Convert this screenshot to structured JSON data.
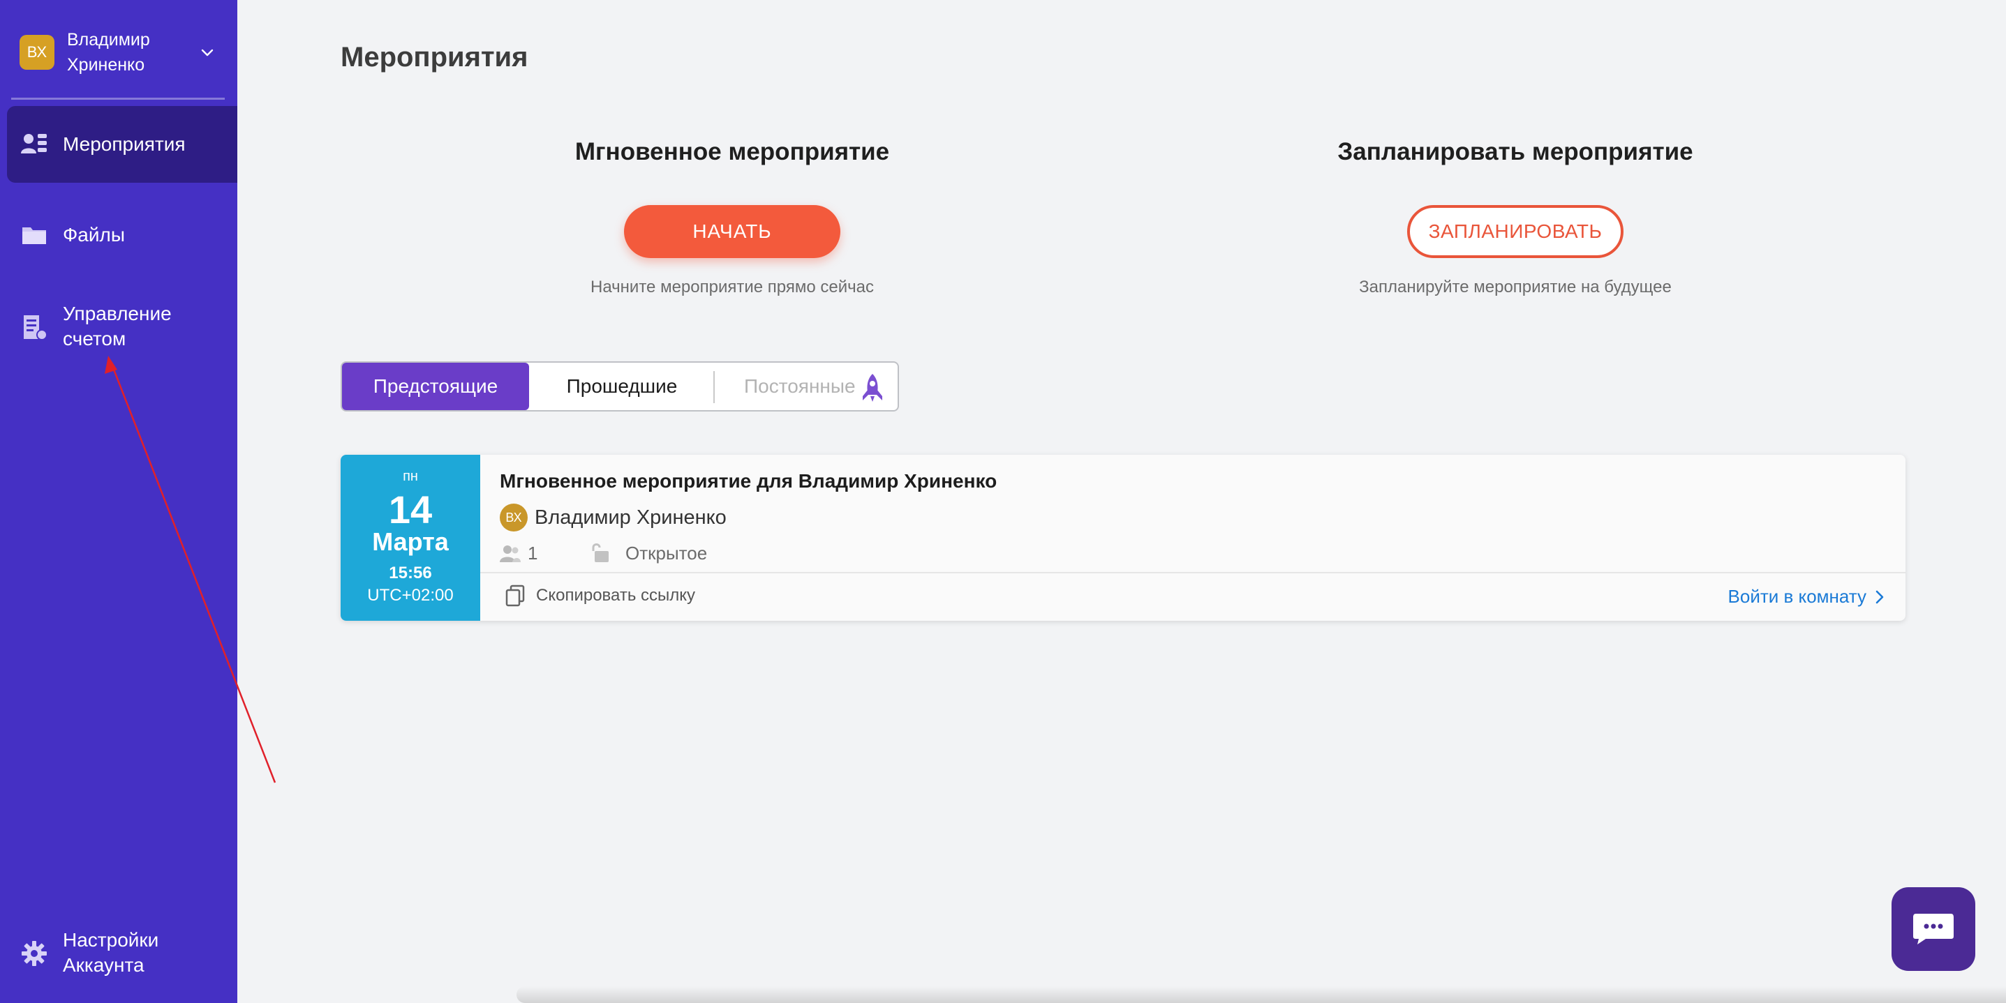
{
  "user": {
    "initials": "ВХ",
    "name": "Владимир Хриненко"
  },
  "sidebar": {
    "items": [
      {
        "label": "Мероприятия",
        "icon": "contacts-icon",
        "active": true
      },
      {
        "label": "Файлы",
        "icon": "folder-icon",
        "active": false
      },
      {
        "label": "Управление счетом",
        "icon": "billing-icon",
        "active": false
      }
    ],
    "settings_label": "Настройки Аккаунта"
  },
  "main": {
    "title": "Мероприятия",
    "instant": {
      "title": "Мгновенное мероприятие",
      "button": "НАЧАТЬ",
      "subtitle": "Начните мероприятие прямо сейчас"
    },
    "schedule": {
      "title": "Запланировать мероприятие",
      "button": "ЗАПЛАНИРОВАТЬ",
      "subtitle": "Запланируйте мероприятие на будущее"
    },
    "tabs": [
      {
        "label": "Предстоящие",
        "active": true
      },
      {
        "label": "Прошедшие",
        "active": false
      },
      {
        "label": "Постоянные",
        "active": false,
        "disabled": true
      }
    ]
  },
  "event": {
    "date": {
      "day_of_week": "пн",
      "day": "14",
      "month": "Марта",
      "time": "15:56",
      "timezone": "UTC+02:00"
    },
    "title": "Мгновенное мероприятие для Владимир Хриненко",
    "owner": {
      "initials": "ВХ",
      "name": "Владимир Хриненко"
    },
    "participants": "1",
    "access": "Открытое",
    "copy_link": "Скопировать ссылку",
    "enter_room": "Войти в комнату"
  },
  "colors": {
    "sidebar_bg": "#4530c4",
    "sidebar_active": "#2e1d85",
    "primary_button": "#f35a3c",
    "tab_active": "#6a3dc8",
    "date_box": "#1ea8d8",
    "link": "#1a7ad6",
    "annotation_arrow": "#e0202a"
  }
}
